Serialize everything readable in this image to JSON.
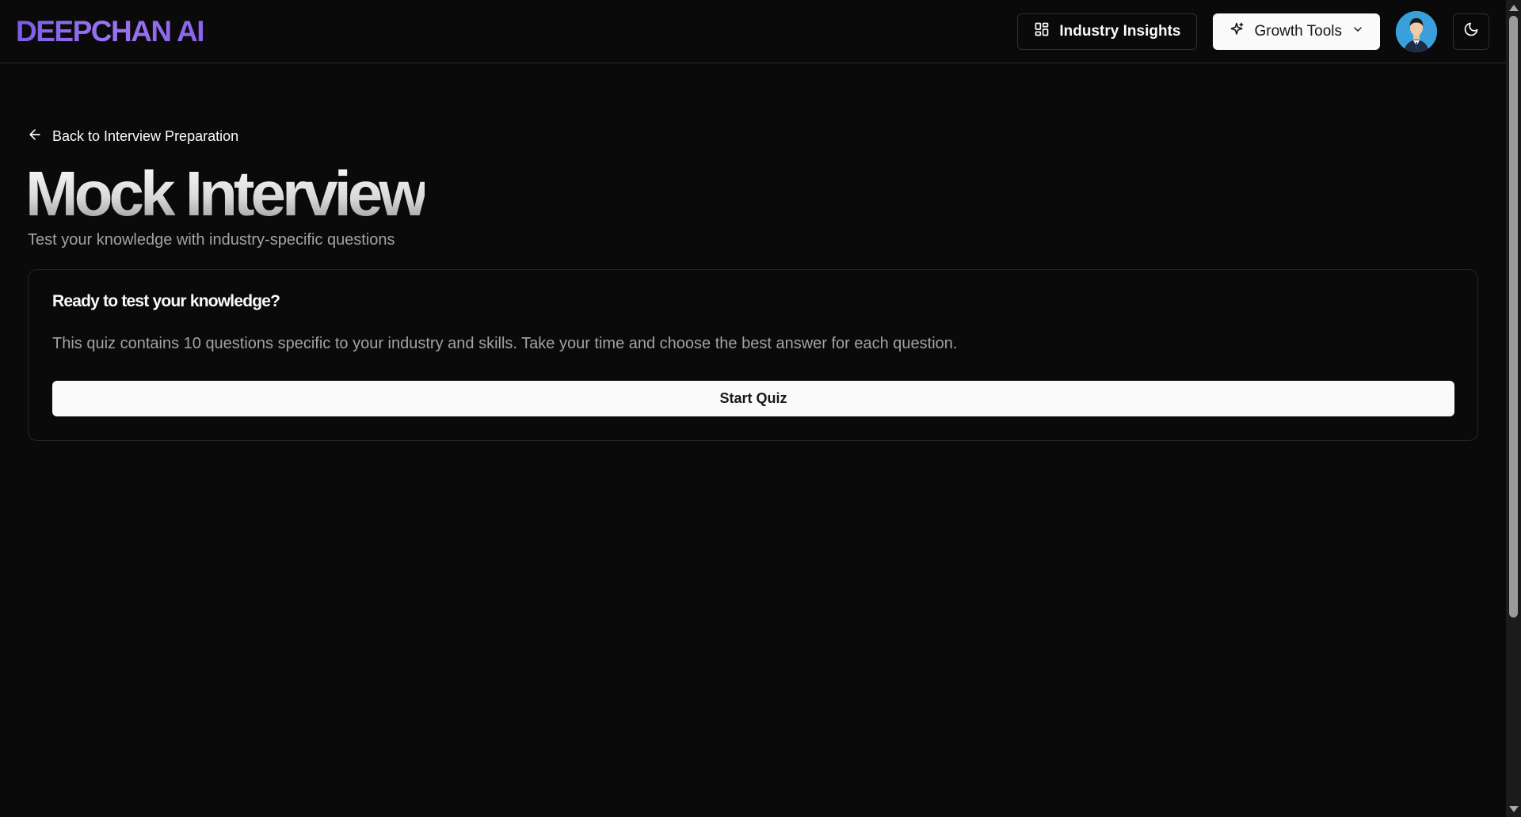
{
  "header": {
    "logo": "DEEPCHAN AI",
    "industry_insights_label": "Industry Insights",
    "growth_tools_label": "Growth Tools",
    "icons": {
      "insights": "layout-dashboard-icon",
      "growth": "sparkles-icon",
      "chevron": "chevron-down-icon",
      "theme": "moon-icon"
    }
  },
  "main": {
    "back_link": "Back to Interview Preparation",
    "title": "Mock Interview",
    "subtitle": "Test your knowledge with industry-specific questions",
    "card": {
      "title": "Ready to test your knowledge?",
      "description": "This quiz contains 10 questions specific to your industry and skills. Take your time and choose the best answer for each question.",
      "start_button": "Start Quiz"
    }
  },
  "colors": {
    "background": "#0a0a0a",
    "logo_accent": "#8a63ea",
    "border": "#262626",
    "muted_text": "#a3a3a3",
    "primary_button": "#fafafa"
  }
}
